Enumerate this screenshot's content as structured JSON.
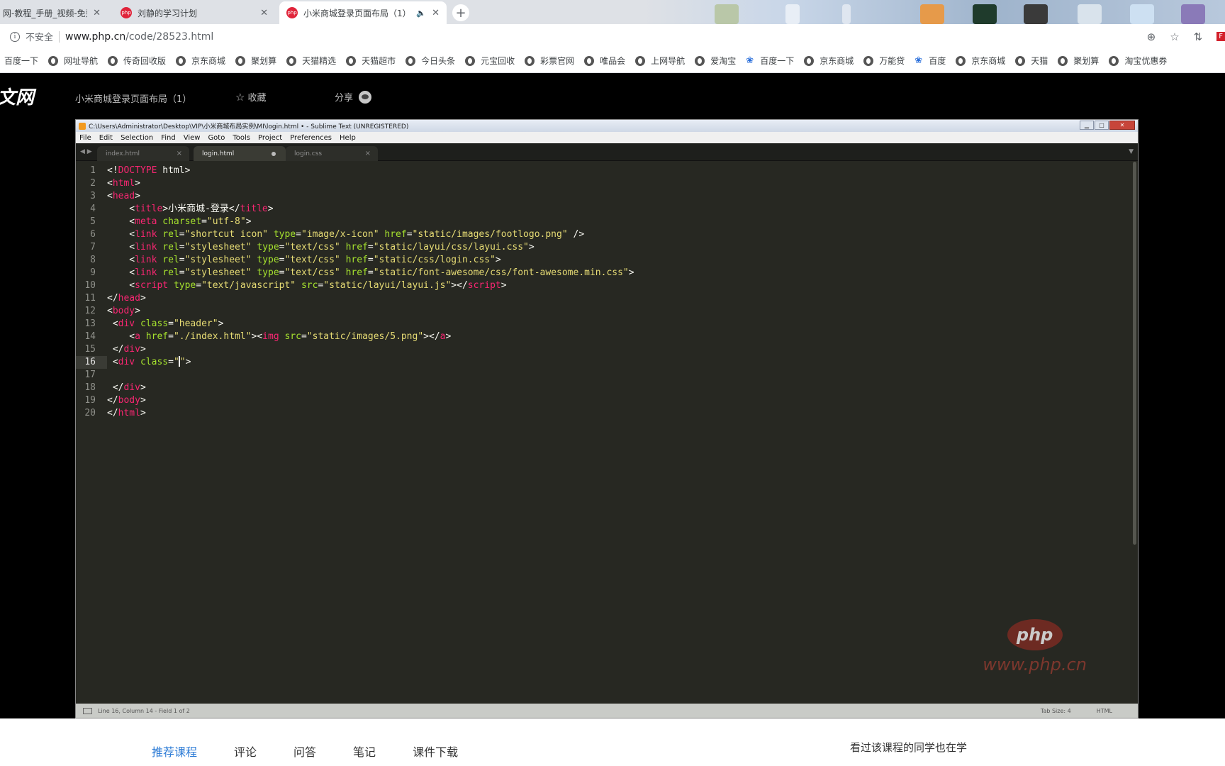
{
  "browser": {
    "tabs": [
      {
        "title": "网-教程_手册_视频-免费",
        "favicon": "none",
        "active": false
      },
      {
        "title": "刘静的学习计划",
        "favicon": "php",
        "active": false
      },
      {
        "title": "小米商城登录页面布局（1）",
        "favicon": "php",
        "active": true
      }
    ],
    "favicon_text": "php",
    "close_symbol": "✕",
    "new_tab_symbol": "+",
    "address": {
      "security_text": "不安全",
      "url_host": "www.php.cn",
      "url_path": "/code/28523.html"
    },
    "bookmarks": [
      {
        "label": "百度一下",
        "icon": "none"
      },
      {
        "label": "网址导航",
        "icon": "globe"
      },
      {
        "label": "传奇回收版",
        "icon": "globe"
      },
      {
        "label": "京东商城",
        "icon": "globe"
      },
      {
        "label": "聚划算",
        "icon": "globe"
      },
      {
        "label": "天猫精选",
        "icon": "globe"
      },
      {
        "label": "天猫超市",
        "icon": "globe"
      },
      {
        "label": "今日头条",
        "icon": "globe"
      },
      {
        "label": "元宝回收",
        "icon": "globe"
      },
      {
        "label": "彩票官网",
        "icon": "globe"
      },
      {
        "label": "唯品会",
        "icon": "globe"
      },
      {
        "label": "上网导航",
        "icon": "globe"
      },
      {
        "label": "爱淘宝",
        "icon": "globe"
      },
      {
        "label": "百度一下",
        "icon": "paw"
      },
      {
        "label": "京东商城",
        "icon": "globe"
      },
      {
        "label": "万能贷",
        "icon": "globe"
      },
      {
        "label": "百度",
        "icon": "paw"
      },
      {
        "label": "京东商城",
        "icon": "globe"
      },
      {
        "label": "天猫",
        "icon": "globe"
      },
      {
        "label": "聚划算",
        "icon": "globe"
      },
      {
        "label": "淘宝优惠券",
        "icon": "globe"
      }
    ]
  },
  "site": {
    "logo_text": "文网",
    "course_title": "小米商城登录页面布局（1）",
    "collect_label": "收藏",
    "share_label": "分享"
  },
  "sublime": {
    "title": "C:\\Users\\Administrator\\Desktop\\VIP\\小米商城布局实例\\MI\\login.html • - Sublime Text (UNREGISTERED)",
    "menu": [
      "File",
      "Edit",
      "Selection",
      "Find",
      "View",
      "Goto",
      "Tools",
      "Project",
      "Preferences",
      "Help"
    ],
    "tabs": [
      {
        "name": "index.html",
        "active": false,
        "modified": false
      },
      {
        "name": "login.html",
        "active": true,
        "modified": true
      },
      {
        "name": "login.css",
        "active": false,
        "modified": false
      }
    ],
    "current_line": 16,
    "lines": [
      [
        [
          "t",
          "<!"
        ],
        [
          "g",
          "DOCTYPE"
        ],
        [
          "t",
          " html>"
        ]
      ],
      [
        [
          "t",
          "<"
        ],
        [
          "g",
          "html"
        ],
        [
          "t",
          ">"
        ]
      ],
      [
        [
          "t",
          "<"
        ],
        [
          "g",
          "head"
        ],
        [
          "t",
          ">"
        ]
      ],
      [
        [
          "t",
          "    <"
        ],
        [
          "g",
          "title"
        ],
        [
          "t",
          ">小米商城-登录</"
        ],
        [
          "g",
          "title"
        ],
        [
          "t",
          ">"
        ]
      ],
      [
        [
          "t",
          "    <"
        ],
        [
          "g",
          "meta"
        ],
        [
          "t",
          " "
        ],
        [
          "a",
          "charset"
        ],
        [
          "t",
          "="
        ],
        [
          "s",
          "\"utf-8\""
        ],
        [
          "t",
          ">"
        ]
      ],
      [
        [
          "t",
          "    <"
        ],
        [
          "g",
          "link"
        ],
        [
          "t",
          " "
        ],
        [
          "a",
          "rel"
        ],
        [
          "t",
          "="
        ],
        [
          "s",
          "\"shortcut icon\""
        ],
        [
          "t",
          " "
        ],
        [
          "a",
          "type"
        ],
        [
          "t",
          "="
        ],
        [
          "s",
          "\"image/x-icon\""
        ],
        [
          "t",
          " "
        ],
        [
          "a",
          "href"
        ],
        [
          "t",
          "="
        ],
        [
          "s",
          "\"static/images/footlogo.png\""
        ],
        [
          "t",
          " />"
        ]
      ],
      [
        [
          "t",
          "    <"
        ],
        [
          "g",
          "link"
        ],
        [
          "t",
          " "
        ],
        [
          "a",
          "rel"
        ],
        [
          "t",
          "="
        ],
        [
          "s",
          "\"stylesheet\""
        ],
        [
          "t",
          " "
        ],
        [
          "a",
          "type"
        ],
        [
          "t",
          "="
        ],
        [
          "s",
          "\"text/css\""
        ],
        [
          "t",
          " "
        ],
        [
          "a",
          "href"
        ],
        [
          "t",
          "="
        ],
        [
          "s",
          "\"static/layui/css/layui.css\""
        ],
        [
          "t",
          ">"
        ]
      ],
      [
        [
          "t",
          "    <"
        ],
        [
          "g",
          "link"
        ],
        [
          "t",
          " "
        ],
        [
          "a",
          "rel"
        ],
        [
          "t",
          "="
        ],
        [
          "s",
          "\"stylesheet\""
        ],
        [
          "t",
          " "
        ],
        [
          "a",
          "type"
        ],
        [
          "t",
          "="
        ],
        [
          "s",
          "\"text/css\""
        ],
        [
          "t",
          " "
        ],
        [
          "a",
          "href"
        ],
        [
          "t",
          "="
        ],
        [
          "s",
          "\"static/css/login.css\""
        ],
        [
          "t",
          ">"
        ]
      ],
      [
        [
          "t",
          "    <"
        ],
        [
          "g",
          "link"
        ],
        [
          "t",
          " "
        ],
        [
          "a",
          "rel"
        ],
        [
          "t",
          "="
        ],
        [
          "s",
          "\"stylesheet\""
        ],
        [
          "t",
          " "
        ],
        [
          "a",
          "type"
        ],
        [
          "t",
          "="
        ],
        [
          "s",
          "\"text/css\""
        ],
        [
          "t",
          " "
        ],
        [
          "a",
          "href"
        ],
        [
          "t",
          "="
        ],
        [
          "s",
          "\"static/font-awesome/css/font-awesome.min.css\""
        ],
        [
          "t",
          ">"
        ]
      ],
      [
        [
          "t",
          "    <"
        ],
        [
          "g",
          "script"
        ],
        [
          "t",
          " "
        ],
        [
          "a",
          "type"
        ],
        [
          "t",
          "="
        ],
        [
          "s",
          "\"text/javascript\""
        ],
        [
          "t",
          " "
        ],
        [
          "a",
          "src"
        ],
        [
          "t",
          "="
        ],
        [
          "s",
          "\"static/layui/layui.js\""
        ],
        [
          "t",
          "></"
        ],
        [
          "g",
          "script"
        ],
        [
          "t",
          ">"
        ]
      ],
      [
        [
          "t",
          "</"
        ],
        [
          "g",
          "head"
        ],
        [
          "t",
          ">"
        ]
      ],
      [
        [
          "t",
          "<"
        ],
        [
          "g",
          "body"
        ],
        [
          "t",
          ">"
        ]
      ],
      [
        [
          "t",
          " <"
        ],
        [
          "g",
          "div"
        ],
        [
          "t",
          " "
        ],
        [
          "a",
          "class"
        ],
        [
          "t",
          "="
        ],
        [
          "s",
          "\"header\""
        ],
        [
          "t",
          ">"
        ]
      ],
      [
        [
          "t",
          "    <"
        ],
        [
          "g",
          "a"
        ],
        [
          "t",
          " "
        ],
        [
          "a",
          "href"
        ],
        [
          "t",
          "="
        ],
        [
          "s",
          "\"./index.html\""
        ],
        [
          "t",
          "><"
        ],
        [
          "g",
          "img"
        ],
        [
          "t",
          " "
        ],
        [
          "a",
          "src"
        ],
        [
          "t",
          "="
        ],
        [
          "s",
          "\"static/images/5.png\""
        ],
        [
          "t",
          "></"
        ],
        [
          "g",
          "a"
        ],
        [
          "t",
          ">"
        ]
      ],
      [
        [
          "t",
          " </"
        ],
        [
          "g",
          "div"
        ],
        [
          "t",
          ">"
        ]
      ],
      [
        [
          "t",
          " <"
        ],
        [
          "g",
          "div"
        ],
        [
          "t",
          " "
        ],
        [
          "a",
          "class"
        ],
        [
          "t",
          "="
        ],
        [
          "s",
          "\""
        ],
        [
          "c",
          ""
        ],
        [
          "s",
          "\""
        ],
        [
          "t",
          ">"
        ]
      ],
      [],
      [
        [
          "t",
          " </"
        ],
        [
          "g",
          "div"
        ],
        [
          "t",
          ">"
        ]
      ],
      [
        [
          "t",
          "</"
        ],
        [
          "g",
          "body"
        ],
        [
          "t",
          ">"
        ]
      ],
      [
        [
          "t",
          "</"
        ],
        [
          "g",
          "html"
        ],
        [
          "t",
          ">"
        ]
      ]
    ],
    "status_left": "Line 16, Column 14 - Field 1 of 2",
    "status_tab_size": "Tab Size: 4",
    "status_syntax": "HTML",
    "watermark_logo": "php",
    "watermark_url": "www.php.cn"
  },
  "lower": {
    "tabs": [
      "推荐课程",
      "评论",
      "问答",
      "笔记",
      "课件下载"
    ],
    "active_tab": 0,
    "side_title": "看过该课程的同学也在学"
  },
  "colors": {
    "tag": "#f92672",
    "attr": "#a6e22e",
    "string": "#e6db74",
    "text": "#f8f8f2",
    "editor_bg": "#272822",
    "active_tab_link": "#2e7cd6"
  }
}
